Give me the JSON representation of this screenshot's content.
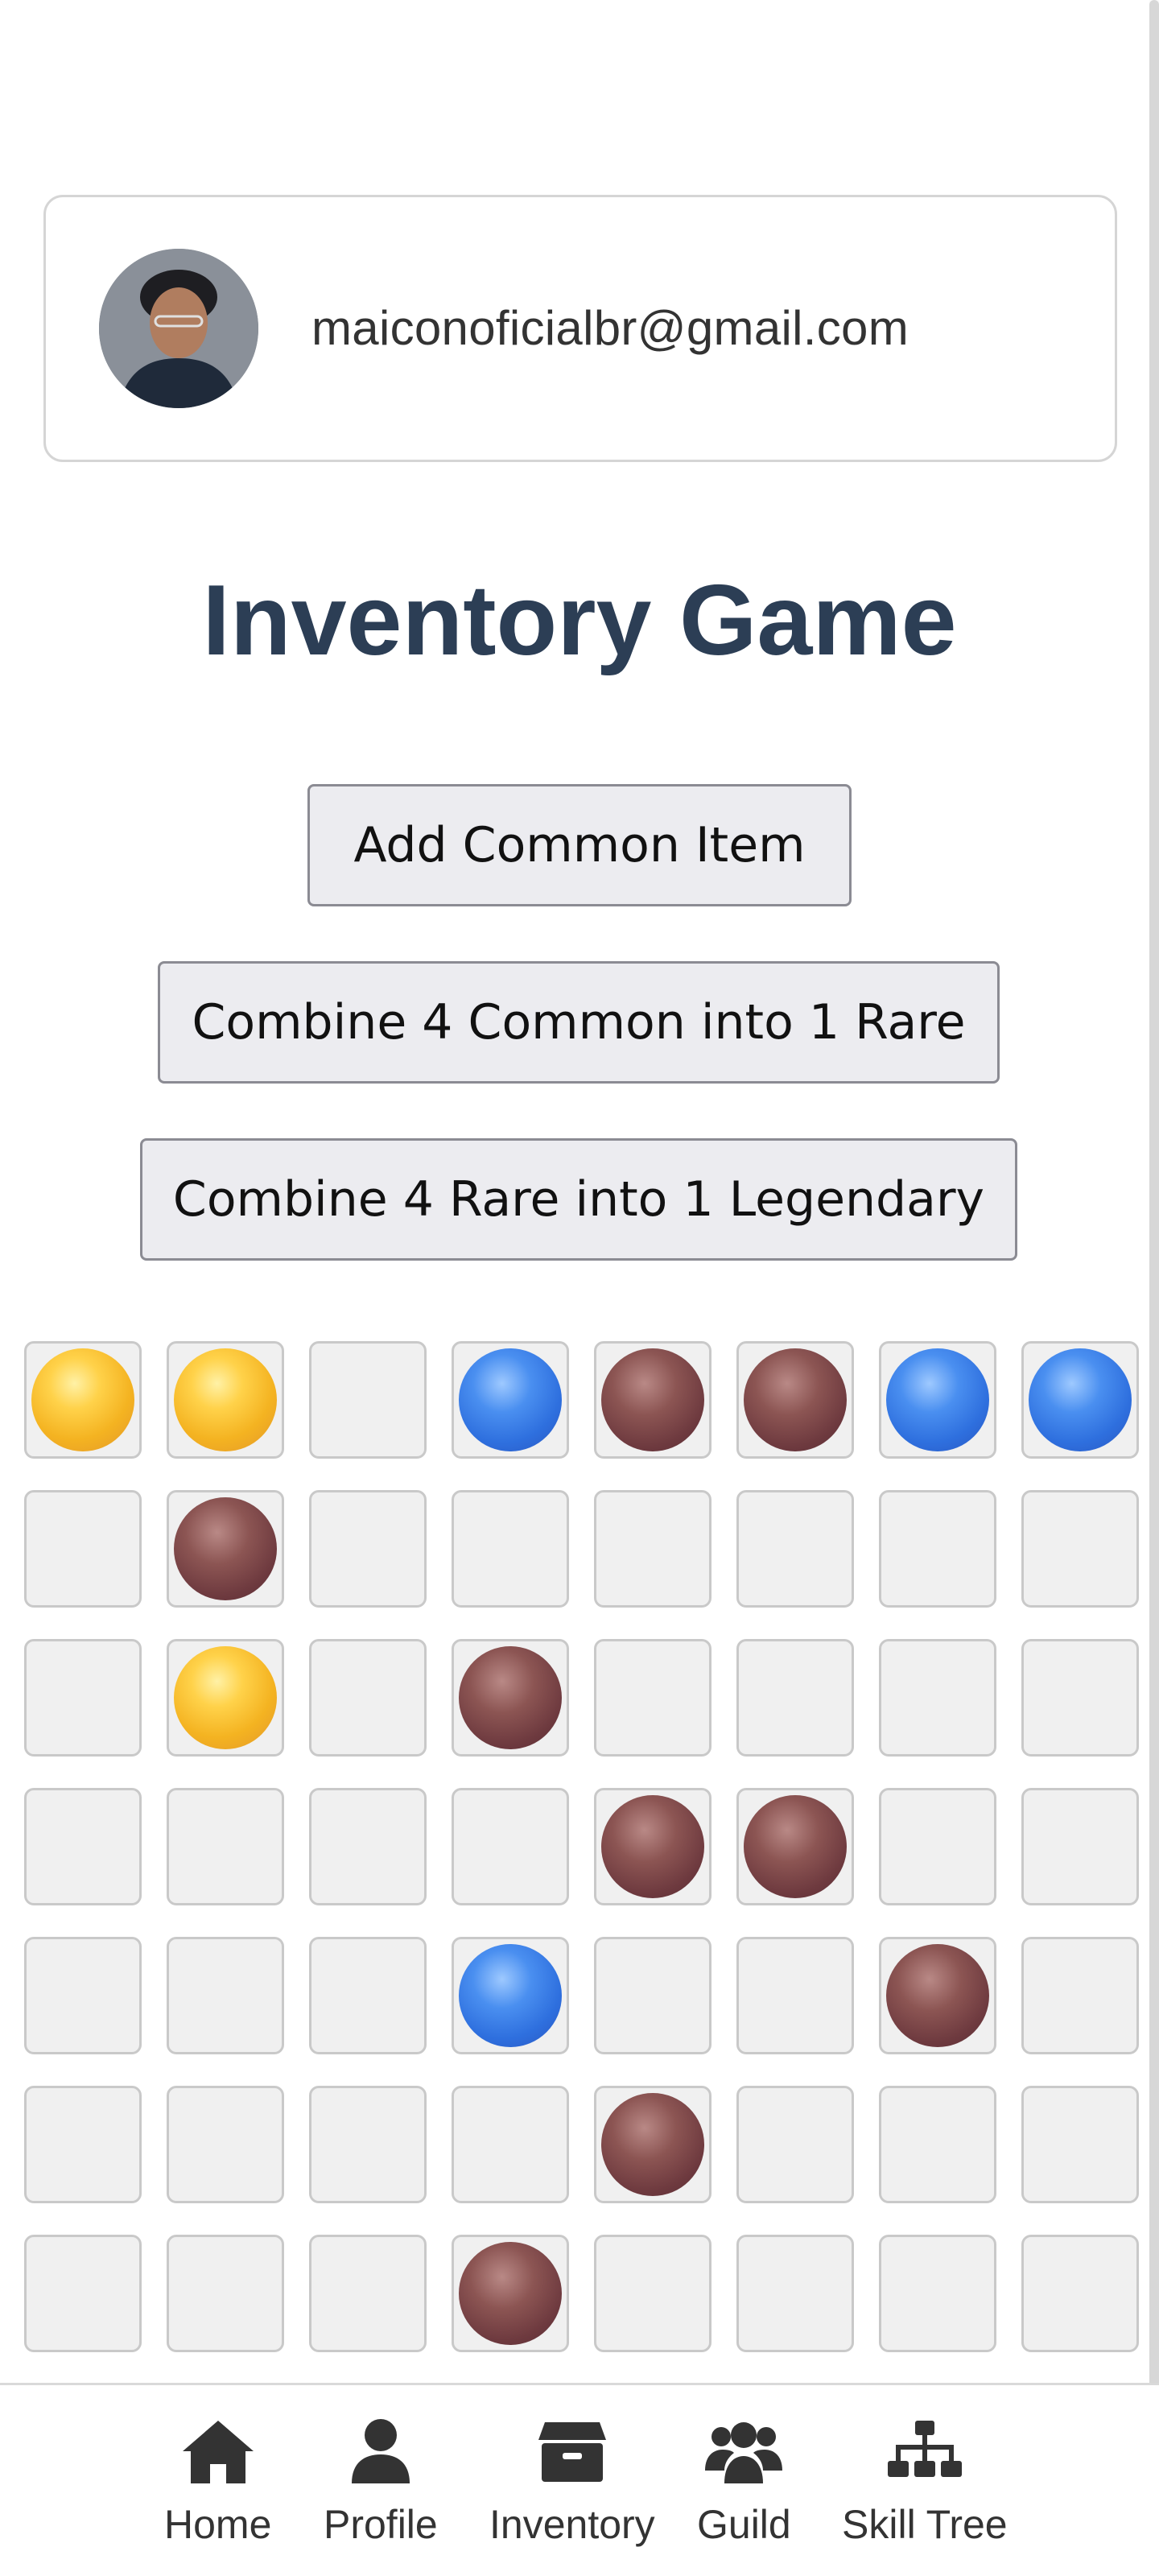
{
  "user": {
    "email": "maiconoficialbr@gmail.com"
  },
  "page": {
    "title": "Inventory Game"
  },
  "actions": {
    "add_common": "Add Common Item",
    "combine_rare": "Combine 4 Common into 1 Rare",
    "combine_legendary": "Combine 4 Rare into 1 Legendary"
  },
  "inventory": {
    "columns": 8,
    "rows": [
      [
        "common",
        "common",
        null,
        "rare",
        "legendary",
        "legendary",
        "rare",
        "rare"
      ],
      [
        null,
        "legendary",
        null,
        null,
        null,
        null,
        null,
        null
      ],
      [
        null,
        "common",
        null,
        "legendary",
        null,
        null,
        null,
        null
      ],
      [
        null,
        null,
        null,
        null,
        "legendary",
        "legendary",
        null,
        null
      ],
      [
        null,
        null,
        null,
        "rare",
        null,
        null,
        "legendary",
        null
      ],
      [
        null,
        null,
        null,
        null,
        "legendary",
        null,
        null,
        null
      ],
      [
        null,
        null,
        null,
        "legendary",
        null,
        null,
        null,
        null
      ]
    ],
    "item_colors": {
      "common": "#f4b321",
      "rare": "#2e6fde",
      "legendary": "#6e3a3f"
    }
  },
  "nav": {
    "items": [
      {
        "label": "Home",
        "icon": "home-icon"
      },
      {
        "label": "Profile",
        "icon": "user-icon"
      },
      {
        "label": "Inventory",
        "icon": "box-icon"
      },
      {
        "label": "Guild",
        "icon": "users-icon"
      },
      {
        "label": "Skill Tree",
        "icon": "sitemap-icon"
      }
    ]
  }
}
